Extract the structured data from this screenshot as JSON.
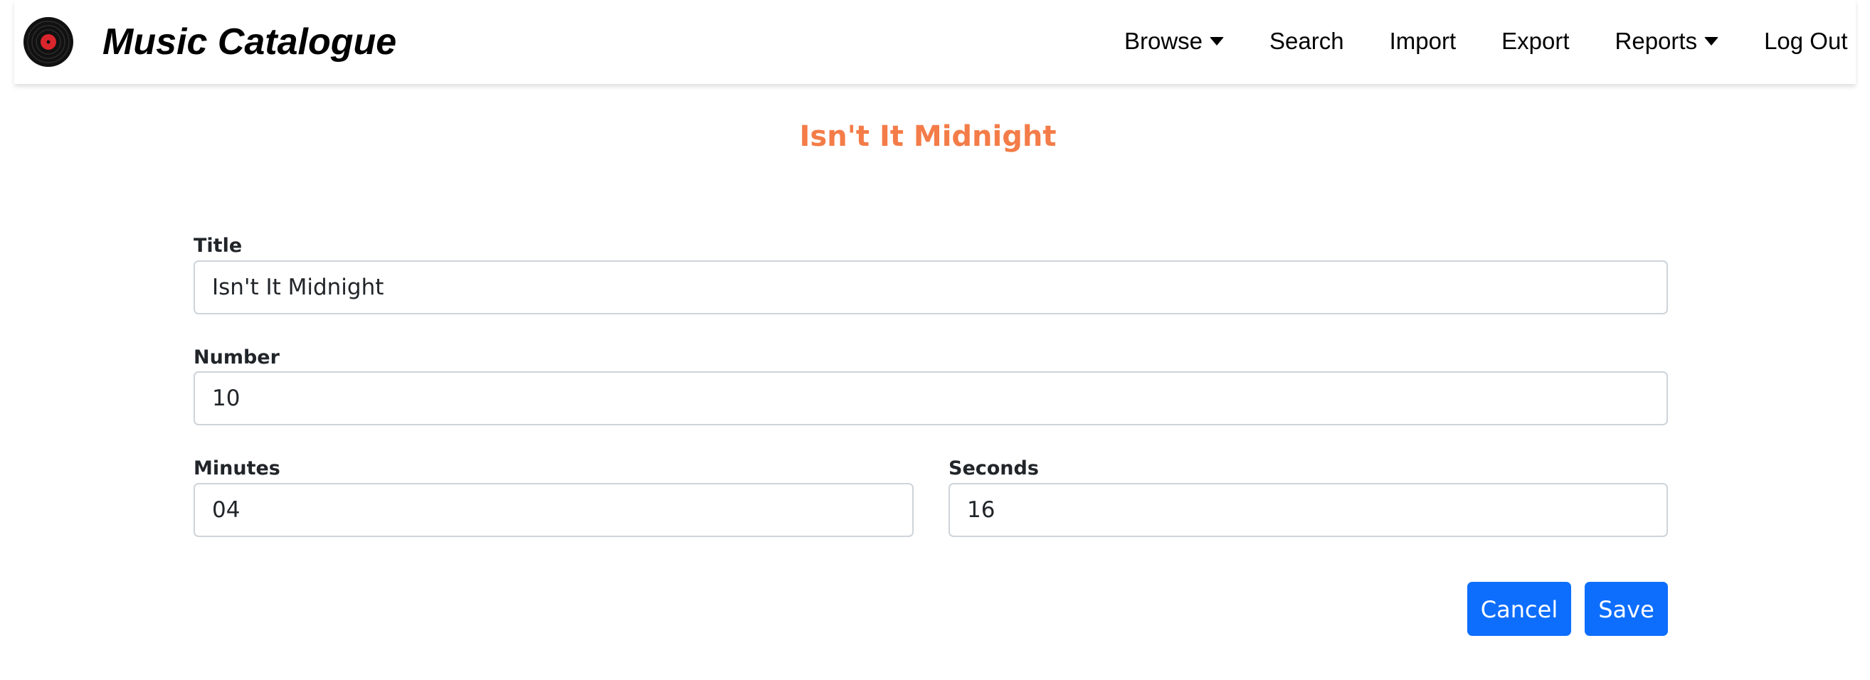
{
  "app": {
    "brand": "Music Catalogue",
    "logo_icon": "vinyl-record-icon"
  },
  "nav": {
    "items": [
      {
        "label": "Browse",
        "dropdown": true
      },
      {
        "label": "Search",
        "dropdown": false
      },
      {
        "label": "Import",
        "dropdown": false
      },
      {
        "label": "Export",
        "dropdown": false
      },
      {
        "label": "Reports",
        "dropdown": true
      },
      {
        "label": "Log Out",
        "dropdown": false
      }
    ],
    "dropdown_icon": "caret-down-icon"
  },
  "page": {
    "title": "Isn't It Midnight"
  },
  "form": {
    "title": {
      "label": "Title",
      "value": "Isn't It Midnight"
    },
    "number": {
      "label": "Number",
      "value": "10"
    },
    "minutes": {
      "label": "Minutes",
      "value": "04"
    },
    "seconds": {
      "label": "Seconds",
      "value": "16"
    }
  },
  "actions": {
    "cancel": "Cancel",
    "save": "Save"
  },
  "colors": {
    "title_accent": "#f47c48",
    "primary_button": "#0d6efd",
    "record_label": "#d9252c"
  }
}
